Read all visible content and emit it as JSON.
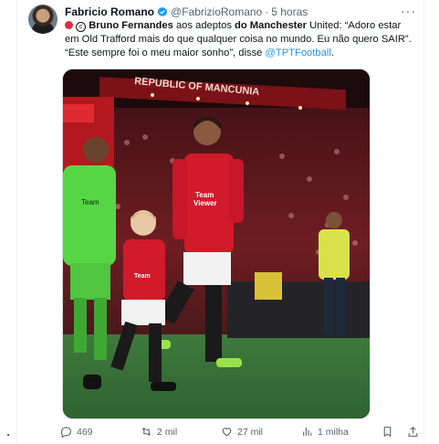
{
  "tweet": {
    "author_name": "Fabricio Romano",
    "handle": "@FabrizioRomano",
    "separator": "·",
    "time": "5 horas",
    "more_label": "···",
    "text": {
      "p1_bold": "Bruno Fernandes",
      "p2": " aos adeptos ",
      "p3_bold": "do Manchester",
      "p4": " United: “Adoro estar em Old Trafford mais do que qualquer coisa no mundo. Eu não quero SAIR”. “Este sempre foi o meu maior sonho”, disse ",
      "link": "@TPTFootball",
      "end": "."
    },
    "image": {
      "banner": "REPUBLIC OF MANCUNIA",
      "sponsor": "TeamViewer",
      "sponsor_lines": [
        "Team",
        "Viewer"
      ]
    }
  },
  "actions": {
    "replies": "469",
    "reposts": "2 mil",
    "likes": "27 mil",
    "views": "1 milha"
  },
  "colors": {
    "accent": "#1d9bf0",
    "muted": "#536471",
    "red_kit": "#d11a2a",
    "gk_kit": "#57d645"
  }
}
